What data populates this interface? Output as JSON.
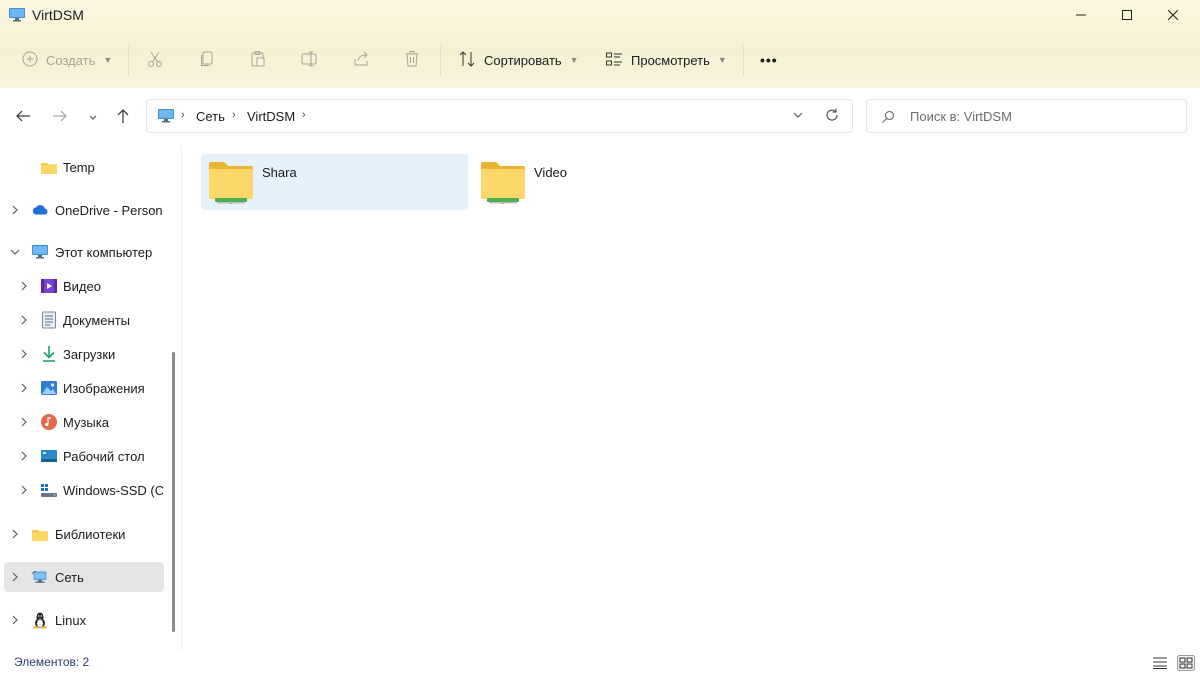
{
  "window": {
    "title": "VirtDSM",
    "minimize_icon": "minimize-icon",
    "maximize_icon": "maximize-icon",
    "close_icon": "close-icon"
  },
  "toolbar": {
    "create_label": "Создать",
    "sort_label": "Сортировать",
    "view_label": "Просмотреть",
    "more_label": "•••",
    "icons": [
      "plus-icon",
      "cut-icon",
      "copy-icon",
      "paste-icon",
      "rename-icon",
      "share-icon",
      "delete-icon",
      "sort-icon",
      "view-icon",
      "more-icon"
    ]
  },
  "address": {
    "crumbs": [
      "Сеть",
      "VirtDSM"
    ],
    "separator": "›",
    "search_placeholder": "Поиск в: VirtDSM"
  },
  "sidebar": {
    "items": [
      {
        "label": "Temp",
        "icon": "folder-icon",
        "expandable": false,
        "selected": false
      },
      {
        "label": "OneDrive - Persona",
        "icon": "onedrive-cloud-icon",
        "expandable": true,
        "selected": false
      },
      {
        "label": "Этот компьютер",
        "icon": "computer-icon",
        "expandable": true,
        "expanded": true,
        "selected": false
      },
      {
        "label": "Видео",
        "icon": "video-icon",
        "expandable": true,
        "selected": false
      },
      {
        "label": "Документы",
        "icon": "documents-icon",
        "expandable": true,
        "selected": false
      },
      {
        "label": "Загрузки",
        "icon": "download-icon",
        "expandable": true,
        "selected": false
      },
      {
        "label": "Изображения",
        "icon": "pictures-icon",
        "expandable": true,
        "selected": false
      },
      {
        "label": "Музыка",
        "icon": "music-icon",
        "expandable": true,
        "selected": false
      },
      {
        "label": "Рабочий стол",
        "icon": "desktop-icon",
        "expandable": true,
        "selected": false
      },
      {
        "label": "Windows-SSD (C:)",
        "icon": "drive-icon",
        "expandable": true,
        "selected": false
      },
      {
        "label": "Библиотеки",
        "icon": "libraries-icon",
        "expandable": true,
        "selected": false
      },
      {
        "label": "Сеть",
        "icon": "network-icon",
        "expandable": true,
        "selected": true
      },
      {
        "label": "Linux",
        "icon": "linux-icon",
        "expandable": true,
        "selected": false
      }
    ]
  },
  "content": {
    "items": [
      {
        "name": "Shara",
        "icon": "network-share-folder-icon",
        "selected": true
      },
      {
        "name": "Video",
        "icon": "network-share-folder-icon",
        "selected": false
      }
    ]
  },
  "status": {
    "item_count": "Элементов: 2"
  },
  "colors": {
    "accent": "#0067c0",
    "folder_yellow": "#f5c84c",
    "share_green": "#4caf50",
    "selection": "#e5f1fb",
    "sidebar_selected": "#e5e5e5",
    "toolbar_band": "#f7f3dc"
  }
}
